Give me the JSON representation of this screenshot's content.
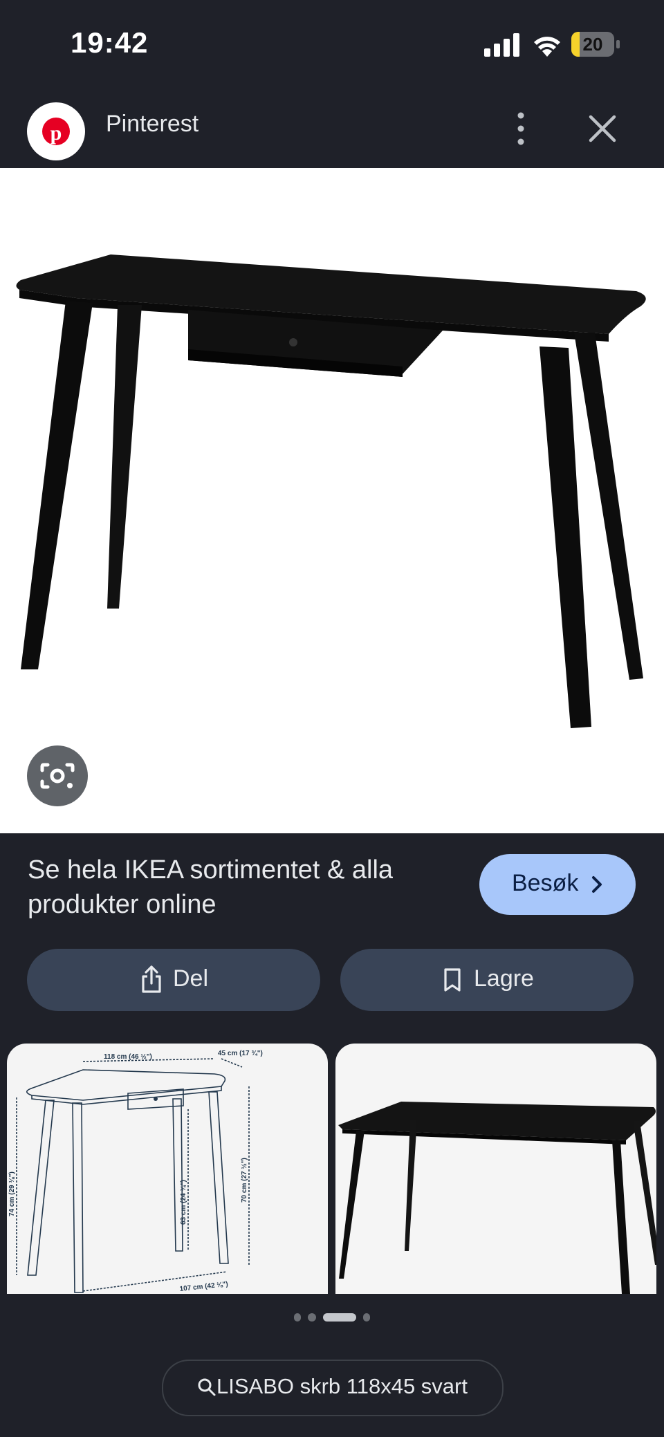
{
  "status_bar": {
    "time": "19:42",
    "battery_level": "20",
    "battery_fraction": 0.2
  },
  "header": {
    "site_name": "Pinterest",
    "logo_icon": "pinterest-logo",
    "more_icon": "more-vert-icon",
    "close_icon": "close-icon"
  },
  "main_image": {
    "subject_icon": "black-desk-with-drawer",
    "lens_icon": "google-lens-icon"
  },
  "info": {
    "caption": "Se hela IKEA sortimentet & alla produkter online",
    "visit_label": "Besøk",
    "share_label": "Del",
    "save_label": "Lagre"
  },
  "related": {
    "left": {
      "width_label": "118 cm (46 ½\")",
      "depth_label": "45 cm (17 ¾\")",
      "height_label": "74 cm (29 ⅛\")",
      "knee_label": "63 cm (24 ¾\")",
      "inner_height_label": "70 cm (27 ½\")",
      "leg_span_label": "107 cm (42 ⅛\")"
    }
  },
  "pager": {
    "count": 4,
    "active_index": 2
  },
  "search_chip": {
    "label": "LISABO skrb 118x45 svart"
  },
  "colors": {
    "background": "#1f2129",
    "accent": "#a8c7fa",
    "pill": "#394457"
  }
}
